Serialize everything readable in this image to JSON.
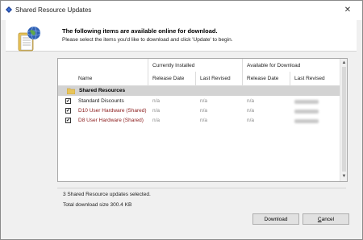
{
  "window": {
    "title": "Shared Resource Updates",
    "close_label": "✕"
  },
  "header": {
    "title": "The following items are available online for download.",
    "subtitle": "Please select the items you'd like to download and click 'Update' to begin."
  },
  "grid": {
    "group_headers": {
      "installed": "Currently Installed",
      "available": "Available for Download"
    },
    "columns": {
      "name": "Name",
      "installed_release": "Release Date",
      "installed_revised": "Last Revised",
      "available_release": "Release Date",
      "available_revised": "Last Revised"
    },
    "section": {
      "label": "Shared Resources"
    },
    "rows": [
      {
        "checked": true,
        "name": "Standard Discounts",
        "installed_release": "n/a",
        "installed_revised": "n/a",
        "available_release": "n/a"
      },
      {
        "checked": true,
        "name": "D10 User Hardware (Shared)",
        "installed_release": "n/a",
        "installed_revised": "n/a",
        "available_release": "n/a"
      },
      {
        "checked": true,
        "name": "D8 User Hardware (Shared)",
        "installed_release": "n/a",
        "installed_revised": "n/a",
        "available_release": "n/a"
      }
    ],
    "checkmark": "✔",
    "scroll_up": "▲",
    "scroll_down": "▼"
  },
  "footer": {
    "selected_text": "3 Shared Resource updates selected.",
    "size_text": "Total download size 300.4 KB"
  },
  "buttons": {
    "download_label": "Download",
    "cancel_prefix": "",
    "cancel_mnemonic": "C",
    "cancel_rest": "ancel"
  }
}
